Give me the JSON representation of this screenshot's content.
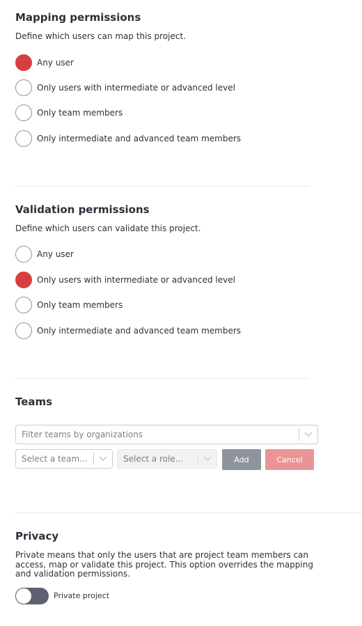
{
  "mapping": {
    "title": "Mapping permissions",
    "description": "Define which users can map this project.",
    "options": [
      {
        "label": "Any user",
        "selected": true
      },
      {
        "label": "Only users with intermediate or advanced level",
        "selected": false
      },
      {
        "label": "Only team members",
        "selected": false
      },
      {
        "label": "Only intermediate and advanced team members",
        "selected": false
      }
    ]
  },
  "validation": {
    "title": "Validation permissions",
    "description": "Define which users can validate this project.",
    "options": [
      {
        "label": "Any user",
        "selected": false
      },
      {
        "label": "Only users with intermediate or advanced level",
        "selected": true
      },
      {
        "label": "Only team members",
        "selected": false
      },
      {
        "label": "Only intermediate and advanced team members",
        "selected": false
      }
    ]
  },
  "teams": {
    "title": "Teams",
    "filter_placeholder": "Filter teams by organizations",
    "team_placeholder": "Select a team...",
    "role_placeholder": "Select a role...",
    "add_label": "Add",
    "cancel_label": "Cancel"
  },
  "privacy": {
    "title": "Privacy",
    "description": "Private means that only the users that are project team members can access, map or validate this project. This option overrides the mapping and validation permissions.",
    "toggle_label": "Private project",
    "private_enabled": false
  },
  "colors": {
    "accent_red": "#d73f3f",
    "button_gray": "#8d949e",
    "button_cancel": "#e99595",
    "toggle_track": "#5c6270"
  }
}
